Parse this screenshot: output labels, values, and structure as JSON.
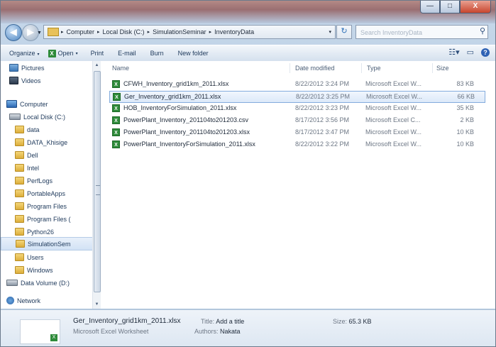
{
  "window": {
    "buttons": {
      "minimize": "—",
      "maximize": "□",
      "close": "X"
    }
  },
  "address": {
    "segments": [
      "Computer",
      "Local Disk (C:)",
      "SimulationSeminar",
      "InventoryData"
    ],
    "separator": "▸",
    "dropdown": "▾"
  },
  "search": {
    "placeholder": "Search InventoryData"
  },
  "toolbar": {
    "organize": "Organize",
    "open": "Open",
    "print": "Print",
    "email": "E-mail",
    "burn": "Burn",
    "new_folder": "New folder",
    "caret": "▾"
  },
  "nav": {
    "items": [
      {
        "label": "Pictures",
        "icon": "pictures-icon"
      },
      {
        "label": "Videos",
        "icon": "videos-icon"
      },
      {
        "label": "Computer",
        "icon": "computer-icon"
      },
      {
        "label": "Local Disk (C:)",
        "icon": "local-disk-icon"
      },
      {
        "label": "data",
        "icon": "folder-icon"
      },
      {
        "label": "DATA_Khisige",
        "icon": "folder-icon"
      },
      {
        "label": "Dell",
        "icon": "folder-icon"
      },
      {
        "label": "Intel",
        "icon": "folder-icon"
      },
      {
        "label": "PerfLogs",
        "icon": "folder-icon"
      },
      {
        "label": "PortableApps",
        "icon": "folder-icon"
      },
      {
        "label": "Program Files",
        "icon": "folder-icon"
      },
      {
        "label": "Program Files (",
        "icon": "folder-icon"
      },
      {
        "label": "Python26",
        "icon": "folder-icon"
      },
      {
        "label": "SimulationSem",
        "icon": "folder-icon",
        "selected": true
      },
      {
        "label": "Users",
        "icon": "folder-icon"
      },
      {
        "label": "Windows",
        "icon": "folder-icon"
      },
      {
        "label": "Data Volume (D:)",
        "icon": "data-volume-icon"
      },
      {
        "label": "Network",
        "icon": "network-icon"
      }
    ]
  },
  "columns": {
    "name": "Name",
    "date": "Date modified",
    "type": "Type",
    "size": "Size"
  },
  "files": [
    {
      "name": "CFWH_Inventory_grid1km_2011.xlsx",
      "date": "8/22/2012 3:24 PM",
      "type": "Microsoft Excel W...",
      "size": "83 KB",
      "selected": false
    },
    {
      "name": "Ger_Inventory_grid1km_2011.xlsx",
      "date": "8/22/2012 3:25 PM",
      "type": "Microsoft Excel W...",
      "size": "66 KB",
      "selected": true
    },
    {
      "name": "HOB_InventoryForSimulation_2011.xlsx",
      "date": "8/22/2012 3:23 PM",
      "type": "Microsoft Excel W...",
      "size": "35 KB",
      "selected": false
    },
    {
      "name": "PowerPlant_Inventory_201104to201203.csv",
      "date": "8/17/2012 3:56 PM",
      "type": "Microsoft Excel C...",
      "size": "2 KB",
      "selected": false
    },
    {
      "name": "PowerPlant_Inventory_201104to201203.xlsx",
      "date": "8/17/2012 3:47 PM",
      "type": "Microsoft Excel W...",
      "size": "10 KB",
      "selected": false
    },
    {
      "name": "PowerPlant_InventoryForSimulation_2011.xlsx",
      "date": "8/22/2012 3:22 PM",
      "type": "Microsoft Excel W...",
      "size": "10 KB",
      "selected": false
    }
  ],
  "details": {
    "filename": "Ger_Inventory_grid1km_2011.xlsx",
    "filetype": "Microsoft Excel Worksheet",
    "title_label": "Title:",
    "title_value": "Add a title",
    "authors_label": "Authors:",
    "authors_value": "Nakata",
    "size_label": "Size:",
    "size_value": "65.3 KB"
  },
  "colors": {
    "accent": "#2e8b3a",
    "selection": "#dce9f9",
    "text": "#1e395b"
  }
}
